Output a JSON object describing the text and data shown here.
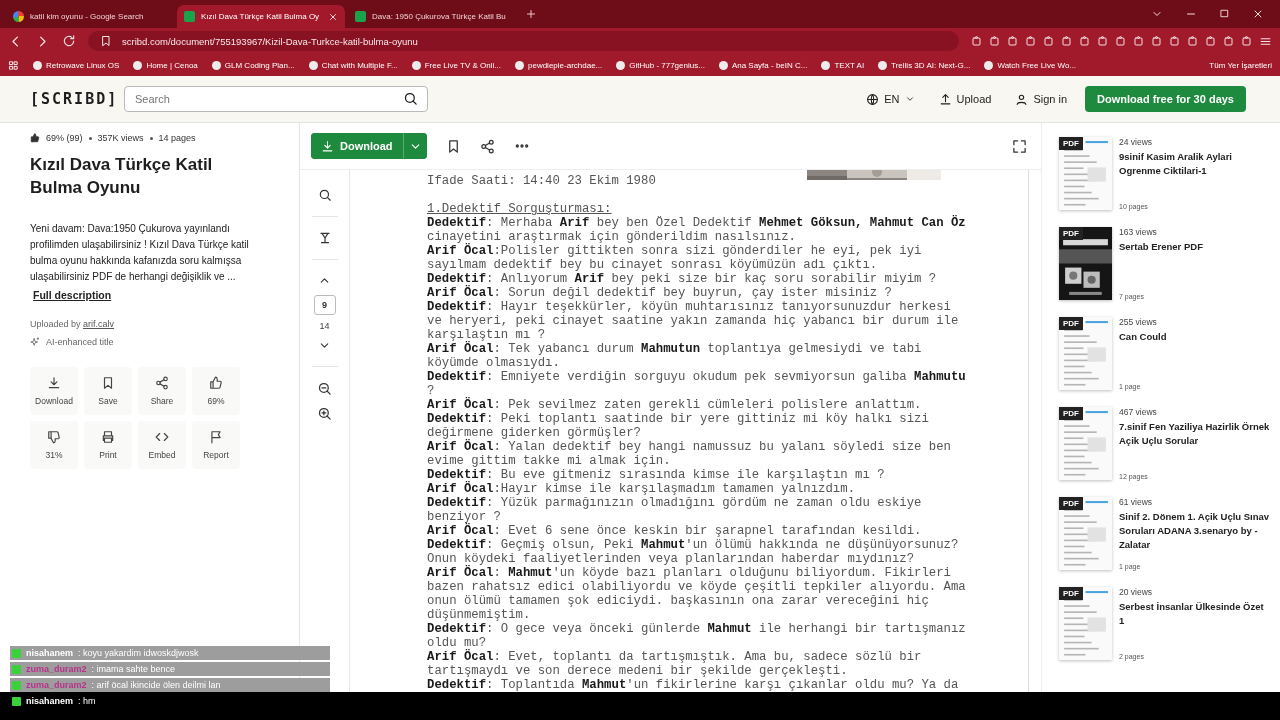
{
  "browser": {
    "tabs": [
      {
        "title": "katil kim oyunu - Google Search",
        "selected": false,
        "kind": "google"
      },
      {
        "title": "Kızıl Dava Türkçe Katil Bulma Oy",
        "selected": true,
        "kind": "scribd"
      },
      {
        "title": "Dava: 1950 Çukurova Türkçe Katil Bu",
        "selected": false,
        "kind": "scribd"
      }
    ],
    "url": "scribd.com/document/755193967/Kizil-Dava-Turkce-katil-bulma-oyunu",
    "bookmarks": [
      "Retrowave Linux OS",
      "Home | Cenoa",
      "GLM Coding Plan...",
      "Chat with Multiple F...",
      "Free Live TV & Onli...",
      "pewdiepie-archdae...",
      "GitHub - 777genius...",
      "Ana Sayfa - beIN C...",
      "TEXT AI",
      "Trellis 3D AI: Next-G...",
      "Watch Free Live Wo..."
    ],
    "all_bookmarks": "Tüm Yer İşaretleri"
  },
  "header": {
    "logo": "[SCRIBD]",
    "search": {
      "placeholder": "Search"
    },
    "language": "EN",
    "upload": "Upload",
    "sign_in": "Sign in",
    "cta": "Download free for 30 days"
  },
  "document": {
    "rating": "69% (99)",
    "views": "357K views",
    "pages": "14 pages",
    "title": "Kızıl Dava Türkçe Katil Bulma Oyunu",
    "description": "Yeni davam: Dava:1950 Çukurova yayınlandı profilimden ulaşabilirsiniz ! Kızıl Dava Türkçe katil bulma oyunu hakkında kafanızda soru kalmışsa ulaşabilirsiniz PDF de herhangi değişiklik ve ...",
    "full_description": "Full description",
    "uploaded_by": "Uploaded by",
    "uploader": "arif.calv",
    "ai_note": "AI-enhanced title",
    "actions": [
      {
        "kind": "download",
        "label": "Download"
      },
      {
        "kind": "save",
        "label": "Save"
      },
      {
        "kind": "share",
        "label": "Share"
      },
      {
        "kind": "upvote",
        "label": "69%"
      },
      {
        "kind": "downvote",
        "label": "31%"
      },
      {
        "kind": "print",
        "label": "Print"
      },
      {
        "kind": "embed",
        "label": "Embed"
      },
      {
        "kind": "report",
        "label": "Report"
      }
    ]
  },
  "viewer": {
    "download": "Download",
    "page": "9",
    "total_pages": "14",
    "meta": "Ifade Saati: 14:40 23 Ekim 1980",
    "heading": "1.Dedektif Sorguşturması:",
    "paragraphs": [
      "**Dedektif**: Merhaba **Arif** bey ben Özel Dedektif **Mehmet Göksun, Mahmut Can Öz** cinayetini araştırmak için gönderildim nasılsınız.",
      "**Arif Öcal**:Polisler gittikten sonra sizi gönderdiler he eyi, pek iyi sayılmam dedektif bey bu cinayet sonrası köyümüzün adı çıktı.",
      "**Dedektif**: Anlıyorum **Arif** bey peki size bir kaç soru sorabilir miyim ?",
      "**Arif Öcal**: Sorun değil dedektif bey buyrun, çay ister misiniz ?",
      "**Dedektif**: Hayır teşekkürler, köyün muhtarısınız tanıyorsunuzdur herkesi ve heryeri, peki cinayet saatine yakın zamanda hiç yabancı bir durum ile karşılaştın mı ?",
      "**Arif Öcal**: Tek yabancı durum **Mahmutun** toplantıya gelmesiydi ve tabi köyümde olmasıydı.",
      "**Dedektif**: Emniyete verdiğin sorguyu okudum pek sevmiyorsun galiba **Mahmutu** ?",
      "**Arif Öcal**: Pek sevilmez zaten gerekli cümleleri polislere anlattım.",
      "**Dedektif**: Peki toplantı saatinde bir yere gittiniz mi köy halkı sizi değirmene giderken görmüşler?",
      "**Arif Öcal**: Yalan dedektif bey hangi namussuz bu yalanı söyledi size ben evime gittim takke mi almak için.",
      "**Dedektif**: Bu eve gitmeniz sırasında kimse ile karşılaştın mı ?",
      "**Arif Öcal**:Hayır kimse ile karşılaşmadım tamamen yalnızdım.",
      "**Dedektif**: Yüzük parmağınızın olmadığını gördüm ne zaman oldu eskiye benziyor ?",
      "**Arif Öcal**: Evet 6 sene önce keskin bir şarapnel tarafından kesildi.",
      "**Dedektif**: Geçmiş olsun, Peki **Mahmut**'un ölümü hakkında ne düşünüyorsunuz? Onun köydeki faaliyetlerinden veya planlarından haberdar mıydınız?",
      "**Arif Öcal**: **Mahmut**'un köyde bazı planları olduğunu biliyordum. Fikirleri bazen rahatsız edici olabiliyordu ve köyde çeşitli tepkiler alıyordu. Ama onun ölümü tamamen şok ediciydi. başkasının ona zarar vereceğini hiç düşünmemiştim.",
      "**Dedektif**: O gece veya önceki günlerde **Mahmut** ile herhangi bir tartışmanız oldu mu?",
      "**Arif Öcal**: Evet, toplantı da tartışmıştık. Ama bu, sadece sözlü bir tartışmaydı ve son derece medeni bir şekilde gerçekleşti.",
      "**Dedektif**: Toplantıda **Mahmut**'un fikirlerine karşı çıkanlar oldu mu? Ya da"
    ]
  },
  "related": [
    {
      "views": "24 views",
      "title": "9sinif Kasim Aralik Aylari Ogrenme Ciktilari-1",
      "pages": "10 pages",
      "badge": "PDF",
      "kind": "doc"
    },
    {
      "views": "163 views",
      "title": "Sertab Erener PDF",
      "pages": "7 pages",
      "badge": "PDF",
      "kind": "dark"
    },
    {
      "views": "255 views",
      "title": "Can Could",
      "pages": "1 page",
      "badge": "PDF",
      "kind": "doc"
    },
    {
      "views": "467 views",
      "title": "7.sinif Fen Yaziliya Hazirlik Örnek Açik Uçlu Sorular",
      "pages": "12 pages",
      "badge": "PDF",
      "kind": "doc"
    },
    {
      "views": "61 views",
      "title": "Sinif 2. Dönem 1. Açik Uçlu Sınav Soruları ADANA 3.senaryo by - Zalatar",
      "pages": "1 page",
      "badge": "PDF",
      "kind": "doc"
    },
    {
      "views": "20 views",
      "title": "Serbest İnsanlar Ülkesinde Özet 1",
      "pages": "2 pages",
      "badge": "PDF",
      "kind": "doc"
    }
  ],
  "chat": [
    {
      "user": "nisahanem",
      "message": ": koyu yakardim idwoskdjwosk",
      "color": "#ffffff",
      "shaded": true
    },
    {
      "user": "zuma_duram2",
      "message": ": imama sahte bence",
      "color": "#b8328c",
      "shaded": true
    },
    {
      "user": "zuma_duram2",
      "message": ": arif öcal ikincide ölen deilmi lan",
      "color": "#b8328c",
      "shaded": true
    },
    {
      "user": "nisahanem",
      "message": ": hm",
      "color": "#ffffff",
      "shaded": false
    }
  ]
}
